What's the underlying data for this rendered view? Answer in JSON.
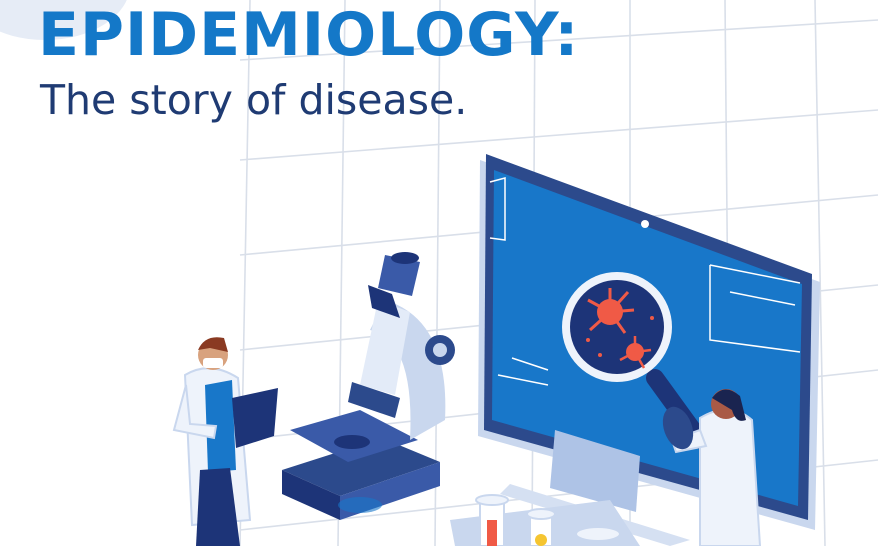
{
  "header": {
    "title": "EPIDEMIOLOGY:",
    "subtitle": "The story of disease."
  },
  "colors": {
    "title_blue": "#1478c8",
    "subtitle_navy": "#1f3b73",
    "screen_blue": "#1877c9",
    "virus_red": "#f05a46",
    "lab_coat": "#eef3fb"
  },
  "illustration": {
    "elements": [
      "grid-background",
      "microscope",
      "scientist-with-tablet",
      "computer-monitor",
      "magnifier-over-virus",
      "scientist-with-magnifier",
      "test-tubes"
    ]
  }
}
